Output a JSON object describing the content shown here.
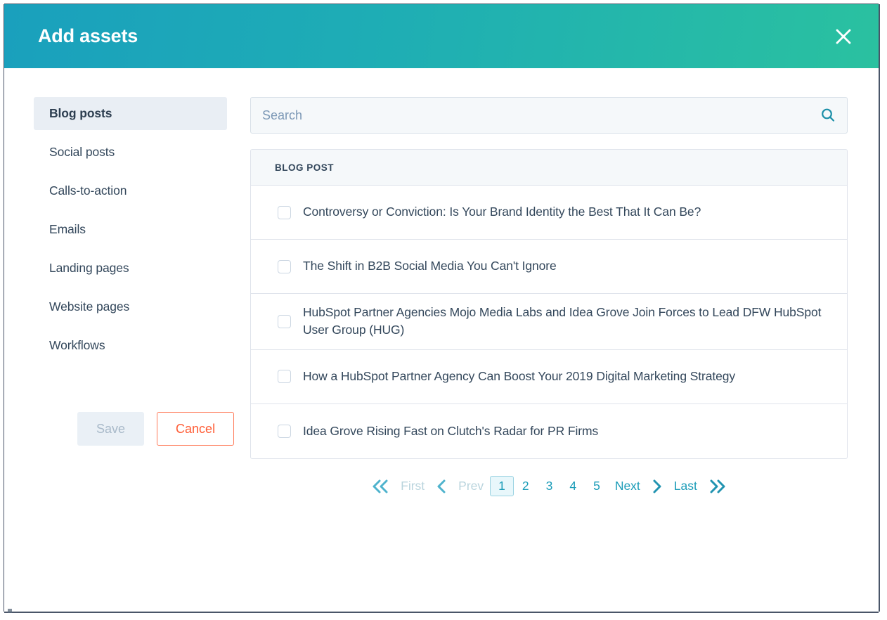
{
  "dialog": {
    "title": "Add assets",
    "close_icon": "close-icon",
    "header_gradient_from": "#1aa0bd",
    "header_gradient_to": "#2ac1a0"
  },
  "sidebar": {
    "items": [
      {
        "label": "Blog posts",
        "active": true
      },
      {
        "label": "Social posts",
        "active": false
      },
      {
        "label": "Calls-to-action",
        "active": false
      },
      {
        "label": "Emails",
        "active": false
      },
      {
        "label": "Landing pages",
        "active": false
      },
      {
        "label": "Website pages",
        "active": false
      },
      {
        "label": "Workflows",
        "active": false
      }
    ]
  },
  "search": {
    "placeholder": "Search",
    "value": "",
    "icon": "search-icon",
    "icon_color": "#1b8fa8"
  },
  "table": {
    "column_header": "BLOG POST",
    "rows": [
      {
        "title": "Controversy or Conviction: Is Your Brand Identity the Best That It Can Be?",
        "checked": false
      },
      {
        "title": "The Shift in B2B Social Media You Can't Ignore",
        "checked": false
      },
      {
        "title": "HubSpot Partner Agencies Mojo Media Labs and Idea Grove Join Forces to Lead DFW HubSpot User Group (HUG)",
        "checked": false
      },
      {
        "title": "How a HubSpot Partner Agency Can Boost Your 2019 Digital Marketing Strategy",
        "checked": false
      },
      {
        "title": "Idea Grove Rising Fast on Clutch's Radar for PR Firms",
        "checked": false
      }
    ]
  },
  "pagination": {
    "first_label": "First",
    "prev_label": "Prev",
    "next_label": "Next",
    "last_label": "Last",
    "pages": [
      "1",
      "2",
      "3",
      "4",
      "5"
    ],
    "current_page": "1",
    "first_enabled": false,
    "prev_enabled": false,
    "next_enabled": true,
    "last_enabled": true,
    "active_color": "#1b9cb8",
    "disabled_color": "#b9d4dd"
  },
  "footer": {
    "save_label": "Save",
    "save_enabled": false,
    "cancel_label": "Cancel",
    "cancel_color": "#ff5c35"
  }
}
